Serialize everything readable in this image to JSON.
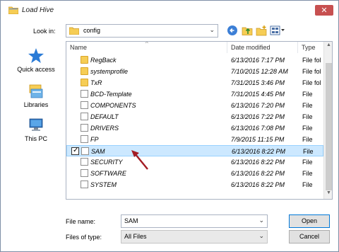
{
  "window": {
    "title": "Load Hive"
  },
  "look_in": {
    "label": "Look in:",
    "value": "config",
    "toolbar_icons": [
      "back-icon",
      "up-folder-icon",
      "new-folder-icon",
      "view-menu-icon"
    ]
  },
  "places": [
    {
      "label": "Quick access",
      "icon": "star-icon"
    },
    {
      "label": "Libraries",
      "icon": "libraries-icon"
    },
    {
      "label": "This PC",
      "icon": "computer-icon"
    }
  ],
  "columns": {
    "name": "Name",
    "date": "Date modified",
    "type": "Type"
  },
  "files": [
    {
      "name": "RegBack",
      "date": "6/13/2016 7:17 PM",
      "type": "File fol",
      "kind": "folder"
    },
    {
      "name": "systemprofile",
      "date": "7/10/2015 12:28 AM",
      "type": "File fol",
      "kind": "folder"
    },
    {
      "name": "TxR",
      "date": "7/31/2015 3:46 PM",
      "type": "File fol",
      "kind": "folder"
    },
    {
      "name": "BCD-Template",
      "date": "7/31/2015 4:45 PM",
      "type": "File",
      "kind": "file"
    },
    {
      "name": "COMPONENTS",
      "date": "6/13/2016 7:20 PM",
      "type": "File",
      "kind": "file"
    },
    {
      "name": "DEFAULT",
      "date": "6/13/2016 7:22 PM",
      "type": "File",
      "kind": "file"
    },
    {
      "name": "DRIVERS",
      "date": "6/13/2016 7:08 PM",
      "type": "File",
      "kind": "file"
    },
    {
      "name": "FP",
      "date": "7/9/2015 11:15 PM",
      "type": "File",
      "kind": "file"
    },
    {
      "name": "SAM",
      "date": "6/13/2016 8:22 PM",
      "type": "File",
      "kind": "file",
      "selected": true,
      "checked": true
    },
    {
      "name": "SECURITY",
      "date": "6/13/2016 8:22 PM",
      "type": "File",
      "kind": "file"
    },
    {
      "name": "SOFTWARE",
      "date": "6/13/2016 8:22 PM",
      "type": "File",
      "kind": "file"
    },
    {
      "name": "SYSTEM",
      "date": "6/13/2016 8:22 PM",
      "type": "File",
      "kind": "file"
    }
  ],
  "file_name": {
    "label": "File name:",
    "value": "SAM"
  },
  "file_type": {
    "label": "Files of type:",
    "value": "All Files"
  },
  "buttons": {
    "open": "Open",
    "cancel": "Cancel"
  },
  "colors": {
    "selection": "#cce8ff",
    "close": "#c75050",
    "annotation_arrow": "#a31c24",
    "folder": "#f6cd55"
  }
}
